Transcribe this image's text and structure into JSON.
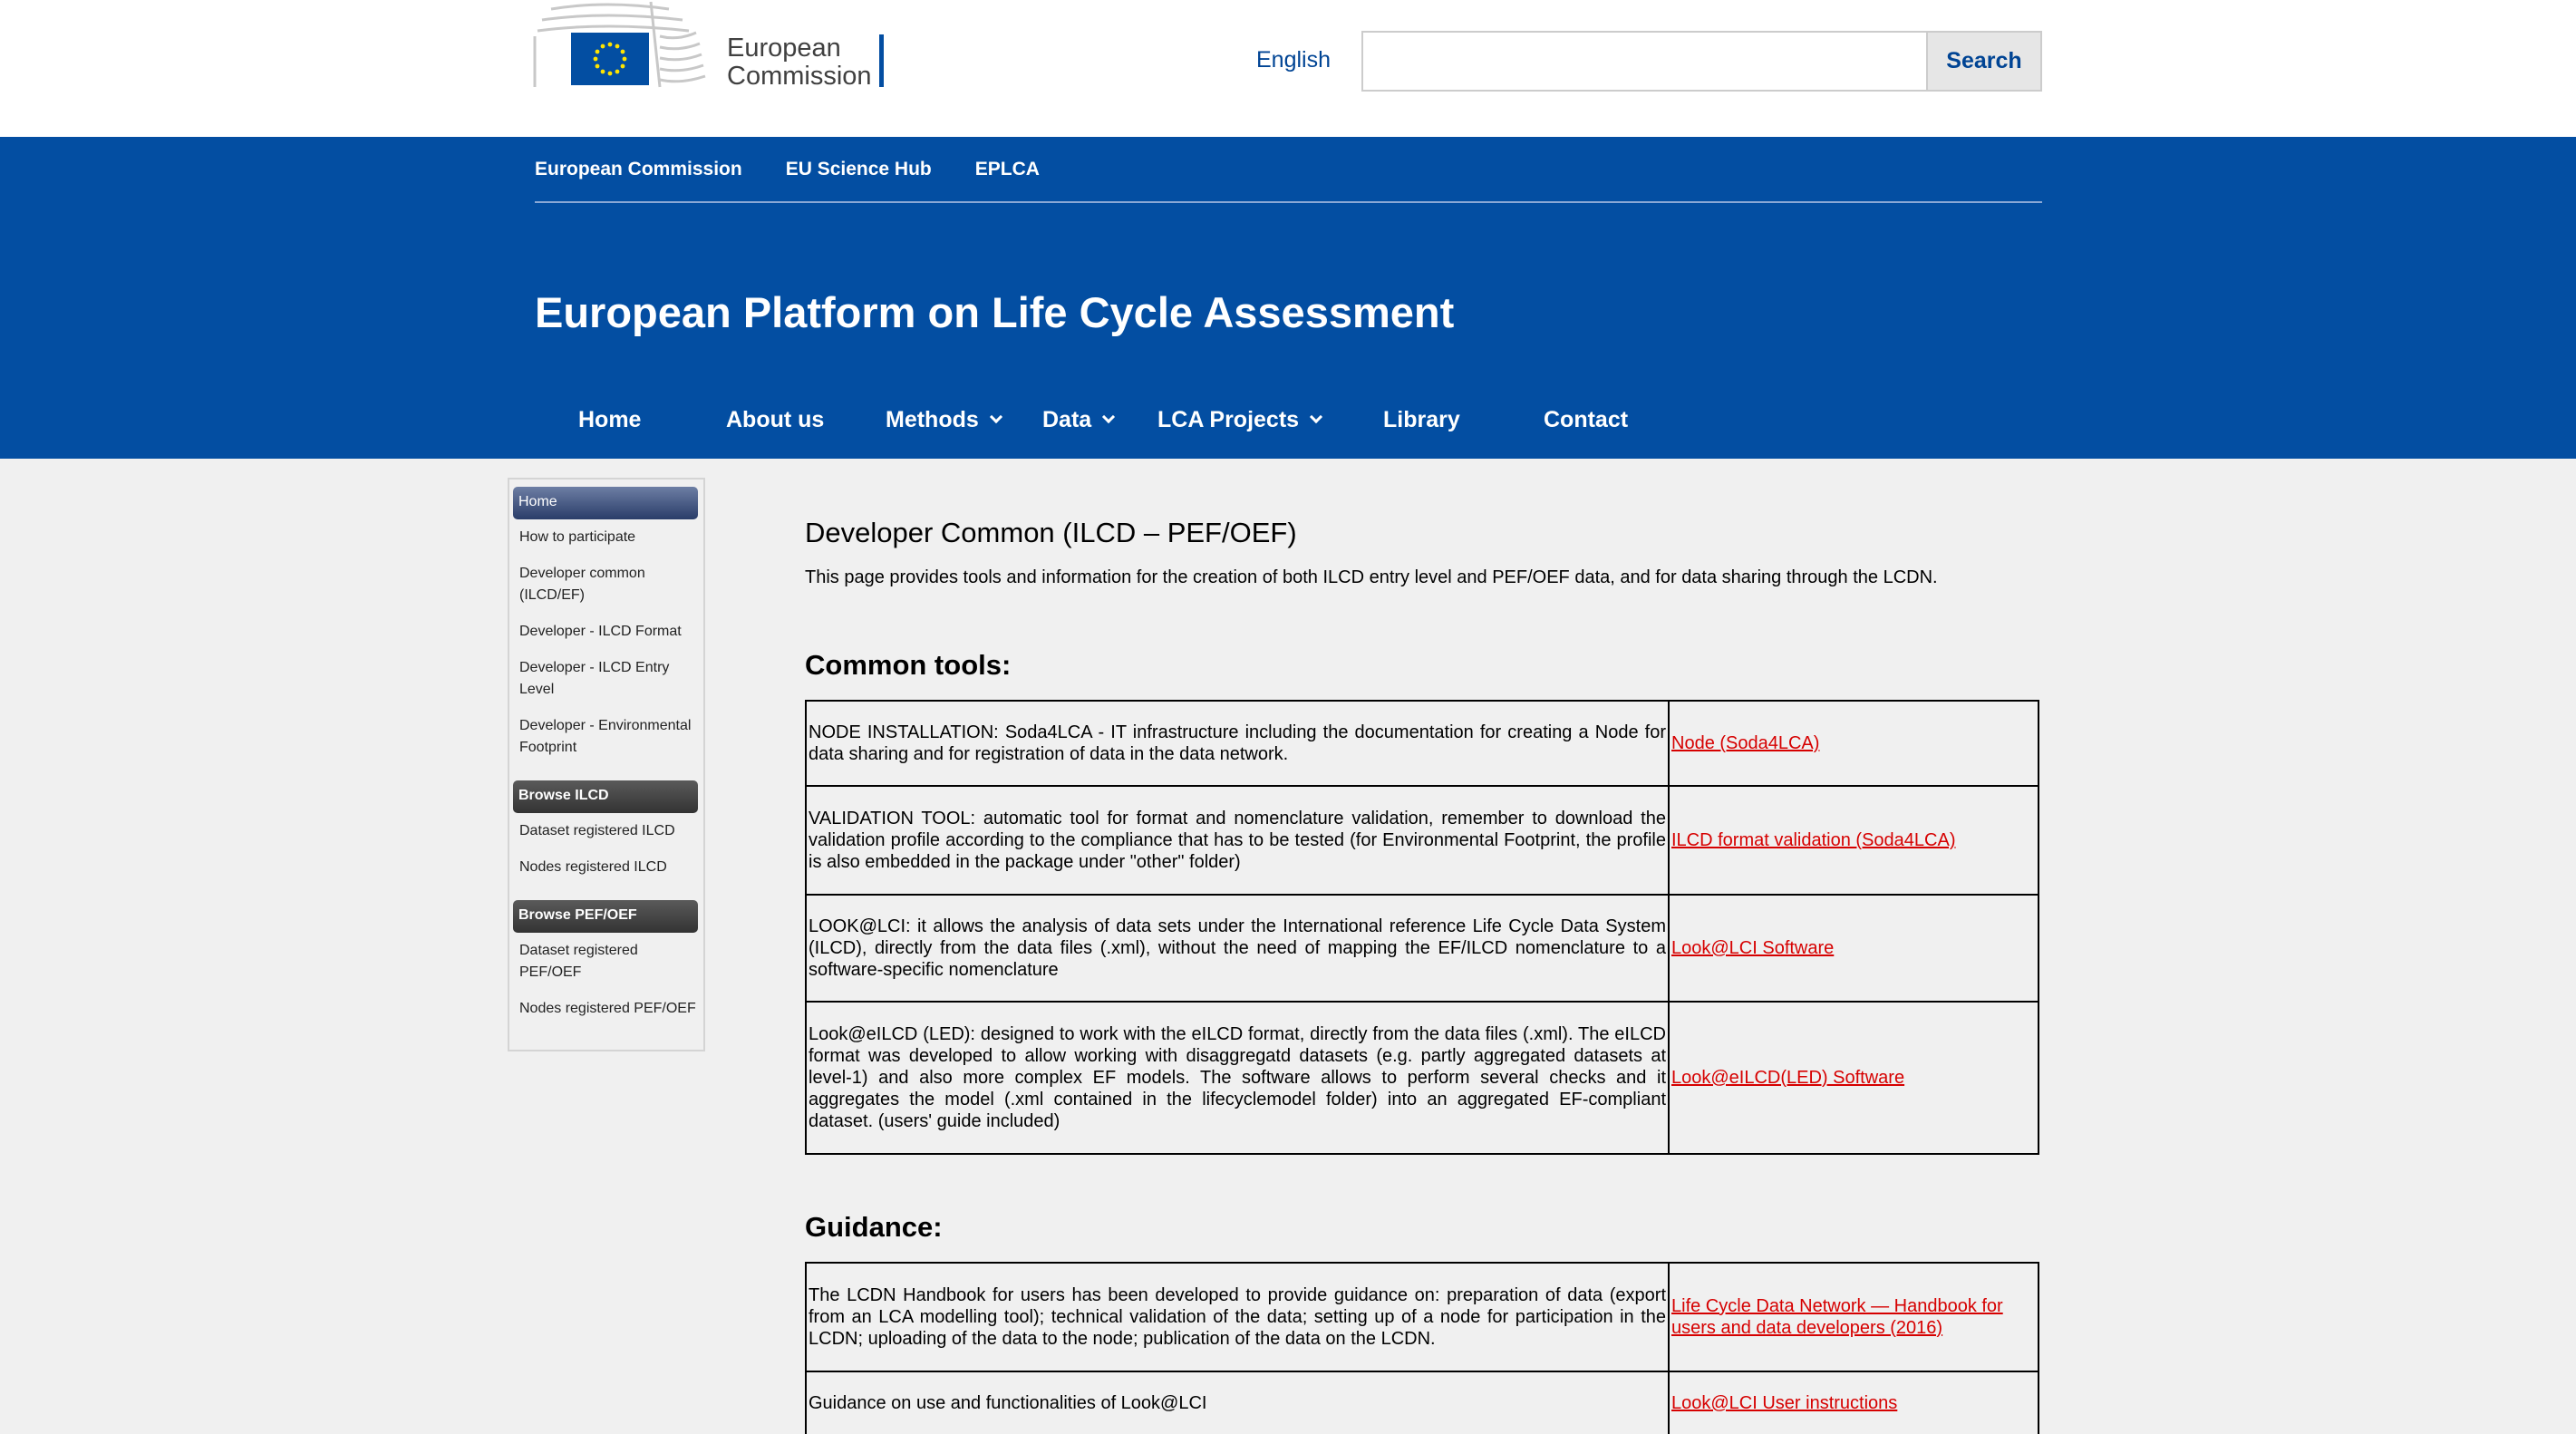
{
  "header": {
    "logo_line1": "European",
    "logo_line2": "Commission",
    "language": "English",
    "search_placeholder": "",
    "search_label": "Search"
  },
  "breadcrumbs": [
    "European Commission",
    "EU Science Hub",
    "EPLCA"
  ],
  "site_title": "European Platform on Life Cycle Assessment",
  "nav": [
    {
      "label": "Home",
      "dropdown": false
    },
    {
      "label": "About us",
      "dropdown": false
    },
    {
      "label": "Methods",
      "dropdown": true
    },
    {
      "label": "Data",
      "dropdown": true
    },
    {
      "label": "LCA Projects",
      "dropdown": true
    },
    {
      "label": "Library",
      "dropdown": false
    },
    {
      "label": "Contact",
      "dropdown": false
    }
  ],
  "sidebar": {
    "home": "Home",
    "items1": [
      "How to participate",
      "Developer common (ILCD/EF)",
      "Developer - ILCD Format",
      "Developer - ILCD Entry Level",
      "Developer - Environmental Footprint"
    ],
    "section2": "Browse ILCD",
    "items2": [
      "Dataset registered ILCD",
      "Nodes registered ILCD"
    ],
    "section3": "Browse PEF/OEF",
    "items3": [
      "Dataset registered PEF/OEF",
      "Nodes registered PEF/OEF"
    ]
  },
  "content": {
    "title": "Developer Common (ILCD – PEF/OEF)",
    "intro": "This page provides tools and information for the creation of both ILCD entry level and PEF/OEF data, and for data sharing through the LCDN.",
    "common_tools_heading": "Common tools:",
    "common_tools": [
      {
        "desc": "NODE INSTALLATION: Soda4LCA - IT infrastructure including the documentation for creating a Node for data sharing and for registration of data in the data network.",
        "link": "Node (Soda4LCA)"
      },
      {
        "desc": "VALIDATION TOOL: automatic tool for format and nomenclature validation, remember to download the validation profile according to the compliance that has to be tested (for Environmental Footprint, the profile is also embedded in the package under \"other\" folder)",
        "link": "ILCD format validation (Soda4LCA)"
      },
      {
        "desc": "LOOK@LCI: it allows the analysis of data sets under the International reference Life Cycle Data System (ILCD), directly from the data files (.xml), without the need of mapping the EF/ILCD nomenclature to a software-specific nomenclature",
        "link": "Look@LCI Software"
      },
      {
        "desc": "Look@eILCD (LED): designed to work with the eILCD format, directly from the data files (.xml). The eILCD format was developed to allow working with disaggregatd datasets (e.g. partly aggregated datasets at level-1) and also more complex EF models. The software allows to perform several checks and it aggregates the model (.xml contained in the lifecyclemodel folder) into an aggregated EF-compliant dataset. (users' guide included)",
        "link": "Look@eILCD(LED) Software"
      }
    ],
    "guidance_heading": "Guidance:",
    "guidance": [
      {
        "desc": "The LCDN Handbook for users has been developed to provide guidance on: preparation of data (export from an LCA modelling tool); technical validation of the data; setting up of a node for participation in the LCDN; uploading of the data to the node; publication of the data on the LCDN.",
        "link": "Life Cycle Data Network — Handbook for users and data developers (2016)"
      },
      {
        "desc": "Guidance on use and functionalities of Look@LCI",
        "link": "Look@LCI User instructions"
      }
    ]
  },
  "colors": {
    "brand_blue": "#034ea2",
    "link_red": "#d60000",
    "page_bg": "#f0f0f0"
  }
}
